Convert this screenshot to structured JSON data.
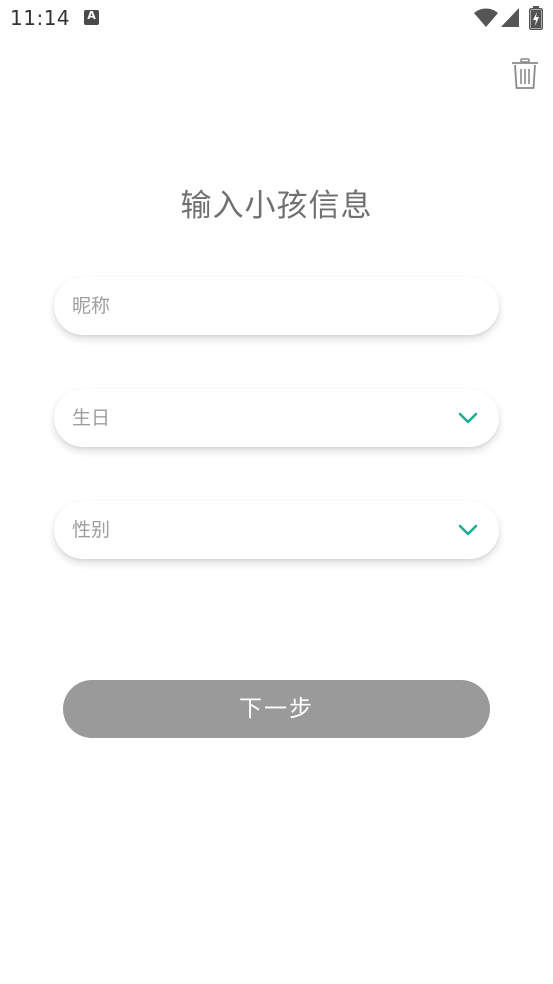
{
  "status_bar": {
    "time": "11:14",
    "notification_letter": "A",
    "icons": [
      "wifi-icon",
      "signal-icon",
      "battery-charging-icon"
    ]
  },
  "toolbar": {
    "trash_icon": "trash-icon"
  },
  "page": {
    "title": "输入小孩信息"
  },
  "form": {
    "nickname": {
      "placeholder": "昵称",
      "value": ""
    },
    "birthday": {
      "label": "生日",
      "icon": "chevron-down-icon"
    },
    "gender": {
      "label": "性别",
      "icon": "chevron-down-icon"
    },
    "next_label": "下一步"
  },
  "colors": {
    "accent": "#1aae94",
    "title_text": "#707070",
    "placeholder_text": "#9e9e9e",
    "button_disabled": "#9a9a9a"
  }
}
